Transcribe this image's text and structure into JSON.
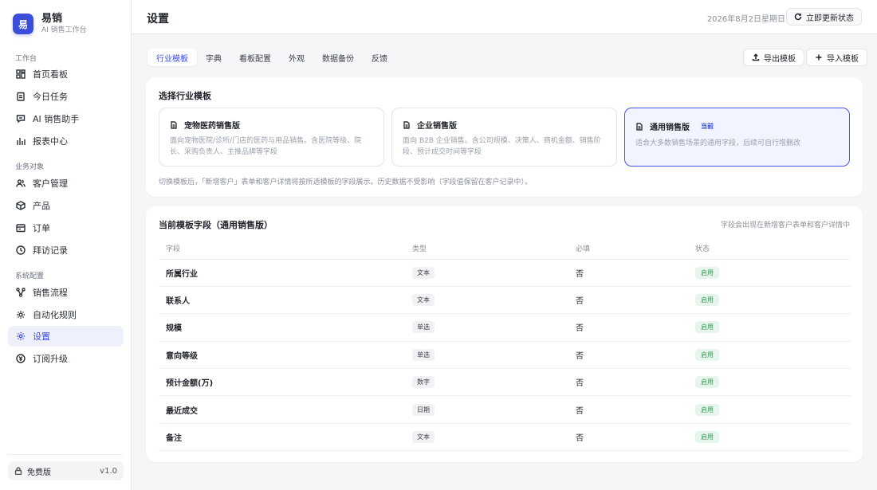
{
  "brand": {
    "logo": "易",
    "name": "易销",
    "subtitle": "AI 销售工作台"
  },
  "sidebar": {
    "sections": [
      {
        "label": "工作台"
      },
      {
        "label": "业务对象"
      },
      {
        "label": "系统配置"
      }
    ],
    "items": [
      {
        "label": "首页看板",
        "icon": "dashboard-icon"
      },
      {
        "label": "今日任务",
        "icon": "clipboard-icon"
      },
      {
        "label": "AI 销售助手",
        "icon": "chat-icon"
      },
      {
        "label": "报表中心",
        "icon": "bar-chart-icon"
      },
      {
        "label": "客户管理",
        "icon": "users-icon"
      },
      {
        "label": "产品",
        "icon": "box-icon"
      },
      {
        "label": "订单",
        "icon": "order-icon"
      },
      {
        "label": "拜访记录",
        "icon": "clock-icon"
      },
      {
        "label": "销售流程",
        "icon": "flow-icon"
      },
      {
        "label": "自动化规则",
        "icon": "gear-icon"
      },
      {
        "label": "设置",
        "icon": "settings-icon"
      },
      {
        "label": "订阅升级",
        "icon": "currency-icon"
      }
    ],
    "plan": {
      "label": "免费版",
      "version": "v1.0"
    }
  },
  "header": {
    "title": "设置",
    "date": "2026年8月2日星期日",
    "refresh_label": "立即更新状态"
  },
  "tabs": [
    {
      "label": "行业模板"
    },
    {
      "label": "字典"
    },
    {
      "label": "看板配置"
    },
    {
      "label": "外观"
    },
    {
      "label": "数据备份"
    },
    {
      "label": "反馈"
    }
  ],
  "actions": {
    "export_label": "导出模板",
    "import_label": "导入模板"
  },
  "templates": {
    "title": "选择行业模板",
    "items": [
      {
        "name": "宠物医药销售版",
        "desc": "面向宠物医院/诊所/门店的医药与用品销售。含医院等级、院长、采购负责人、主推品牌等字段"
      },
      {
        "name": "企业销售版",
        "desc": "面向 B2B 企业销售。含公司规模、决策人、商机金额、销售阶段、预计成交时间等字段"
      },
      {
        "name": "通用销售版",
        "badge": "当前",
        "desc": "适合大多数销售场景的通用字段，后续可自行增删改"
      }
    ],
    "note": "切换模板后，「新增客户」表单和客户详情将按所选模板的字段展示。历史数据不受影响（字段值保留在客户记录中）。"
  },
  "fields": {
    "title": "当前模板字段（通用销售版）",
    "hint": "字段会出现在新增客户表单和客户详情中",
    "columns": [
      "字段",
      "类型",
      "必填",
      "状态"
    ],
    "rows": [
      {
        "name": "所属行业",
        "type": "文本",
        "required": "否",
        "status": "启用"
      },
      {
        "name": "联系人",
        "type": "文本",
        "required": "否",
        "status": "启用"
      },
      {
        "name": "规模",
        "type": "单选",
        "required": "否",
        "status": "启用"
      },
      {
        "name": "意向等级",
        "type": "单选",
        "required": "否",
        "status": "启用"
      },
      {
        "name": "预计金额(万)",
        "type": "数字",
        "required": "否",
        "status": "启用"
      },
      {
        "name": "最近成交",
        "type": "日期",
        "required": "否",
        "status": "启用"
      },
      {
        "name": "备注",
        "type": "文本",
        "required": "否",
        "status": "启用"
      }
    ]
  },
  "colors": {
    "accent": "#3b4ed8",
    "success": "#2f9a55",
    "background": "#f5f6f8"
  }
}
